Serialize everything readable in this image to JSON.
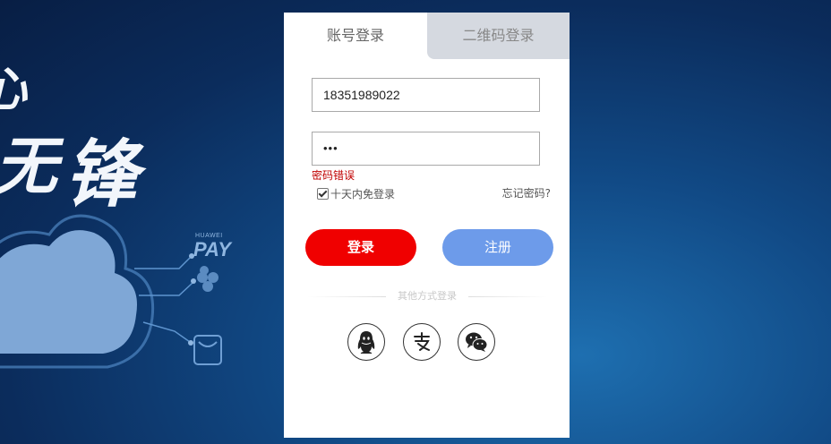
{
  "background": {
    "hero_chars": [
      "心",
      "无",
      "锋"
    ],
    "logos": [
      "HUAWEI",
      "PAY"
    ]
  },
  "tabs": [
    {
      "label": "账号登录",
      "active": true
    },
    {
      "label": "二维码登录",
      "active": false
    }
  ],
  "form": {
    "username": "18351989022",
    "password_mask": "•••",
    "error": "密码错误",
    "remember_label": "十天内免登录",
    "remember_checked": true,
    "forgot_label": "忘记密码?"
  },
  "buttons": {
    "login": "登录",
    "register": "注册"
  },
  "other_login": {
    "label": "其他方式登录",
    "providers": [
      "qq-icon",
      "alipay-icon",
      "wechat-icon"
    ]
  },
  "colors": {
    "login_button": "#f00000",
    "register_button": "#6d9bea",
    "error_text": "#c00000",
    "inactive_tab": "#d5d9e0"
  }
}
